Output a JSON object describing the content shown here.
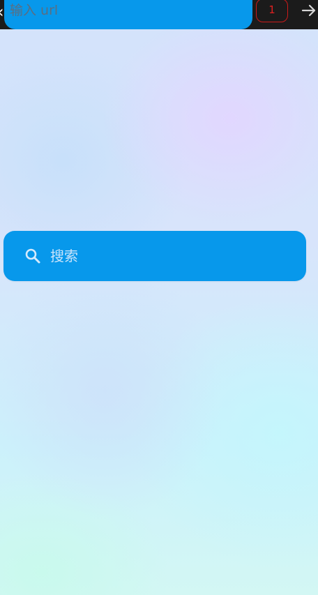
{
  "top_bar": {
    "back_icon": "back-arrow-icon",
    "url_input": {
      "value": "",
      "placeholder": "输入 url"
    },
    "tab_count": "1",
    "go_icon": "arrow-right-icon"
  },
  "search": {
    "icon": "search-icon",
    "label": "搜索"
  },
  "colors": {
    "accent": "#0798eb",
    "top_bar_bg": "#1b1b1b",
    "tab_badge": "#e02020"
  }
}
